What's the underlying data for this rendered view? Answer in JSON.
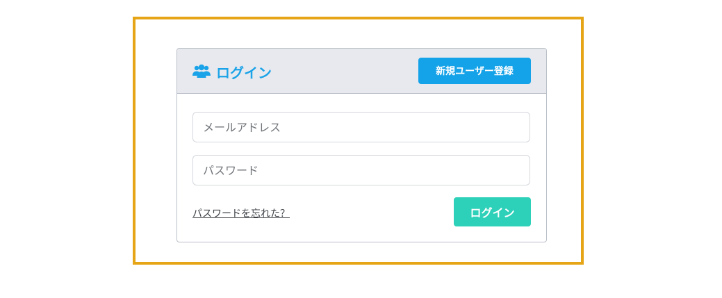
{
  "colors": {
    "frame_border": "#e6a417",
    "title": "#1aa3e8",
    "signup_button": "#14a2e8",
    "login_button": "#2dd0b8",
    "header_bg": "#e8e9ee"
  },
  "header": {
    "icon": "users-icon",
    "title": "ログイン",
    "signup_label": "新規ユーザー登録"
  },
  "form": {
    "email_placeholder": "メールアドレス",
    "email_value": "",
    "password_placeholder": "パスワード",
    "password_value": "",
    "forgot_label": "パスワードを忘れた？",
    "login_label": "ログイン"
  }
}
